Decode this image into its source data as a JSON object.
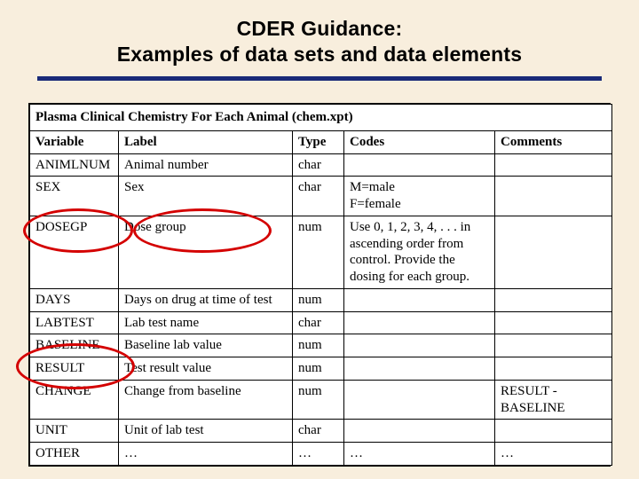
{
  "title_line1": "CDER Guidance:",
  "title_line2": "Examples of data sets and data elements",
  "section_title": "Plasma Clinical Chemistry For Each Animal (chem.xpt)",
  "columns": {
    "variable": "Variable",
    "label": "Label",
    "type": "Type",
    "codes": "Codes",
    "comments": "Comments"
  },
  "rows": [
    {
      "variable": "ANIMLNUM",
      "label": "Animal number",
      "type": "char",
      "codes": "",
      "comments": ""
    },
    {
      "variable": "SEX",
      "label": "Sex",
      "type": "char",
      "codes": "M=male\nF=female",
      "comments": ""
    },
    {
      "variable": "DOSEGP",
      "label": "Dose group",
      "type": "num",
      "codes": "Use 0, 1, 2, 3, 4, . . . in ascending order from control. Provide the dosing for each group.",
      "comments": ""
    },
    {
      "variable": "DAYS",
      "label": "Days on drug at time of test",
      "type": "num",
      "codes": "",
      "comments": ""
    },
    {
      "variable": "LABTEST",
      "label": "Lab test name",
      "type": "char",
      "codes": "",
      "comments": ""
    },
    {
      "variable": "BASELINE",
      "label": "Baseline lab value",
      "type": "num",
      "codes": "",
      "comments": ""
    },
    {
      "variable": "RESULT",
      "label": "Test result value",
      "type": "num",
      "codes": "",
      "comments": ""
    },
    {
      "variable": "CHANGE",
      "label": "Change from baseline",
      "type": "num",
      "codes": "",
      "comments": "RESULT - BASELINE"
    },
    {
      "variable": "UNIT",
      "label": "Unit of lab test",
      "type": "char",
      "codes": "",
      "comments": ""
    },
    {
      "variable": "OTHER",
      "label": "…",
      "type": "…",
      "codes": "…",
      "comments": "…"
    }
  ]
}
